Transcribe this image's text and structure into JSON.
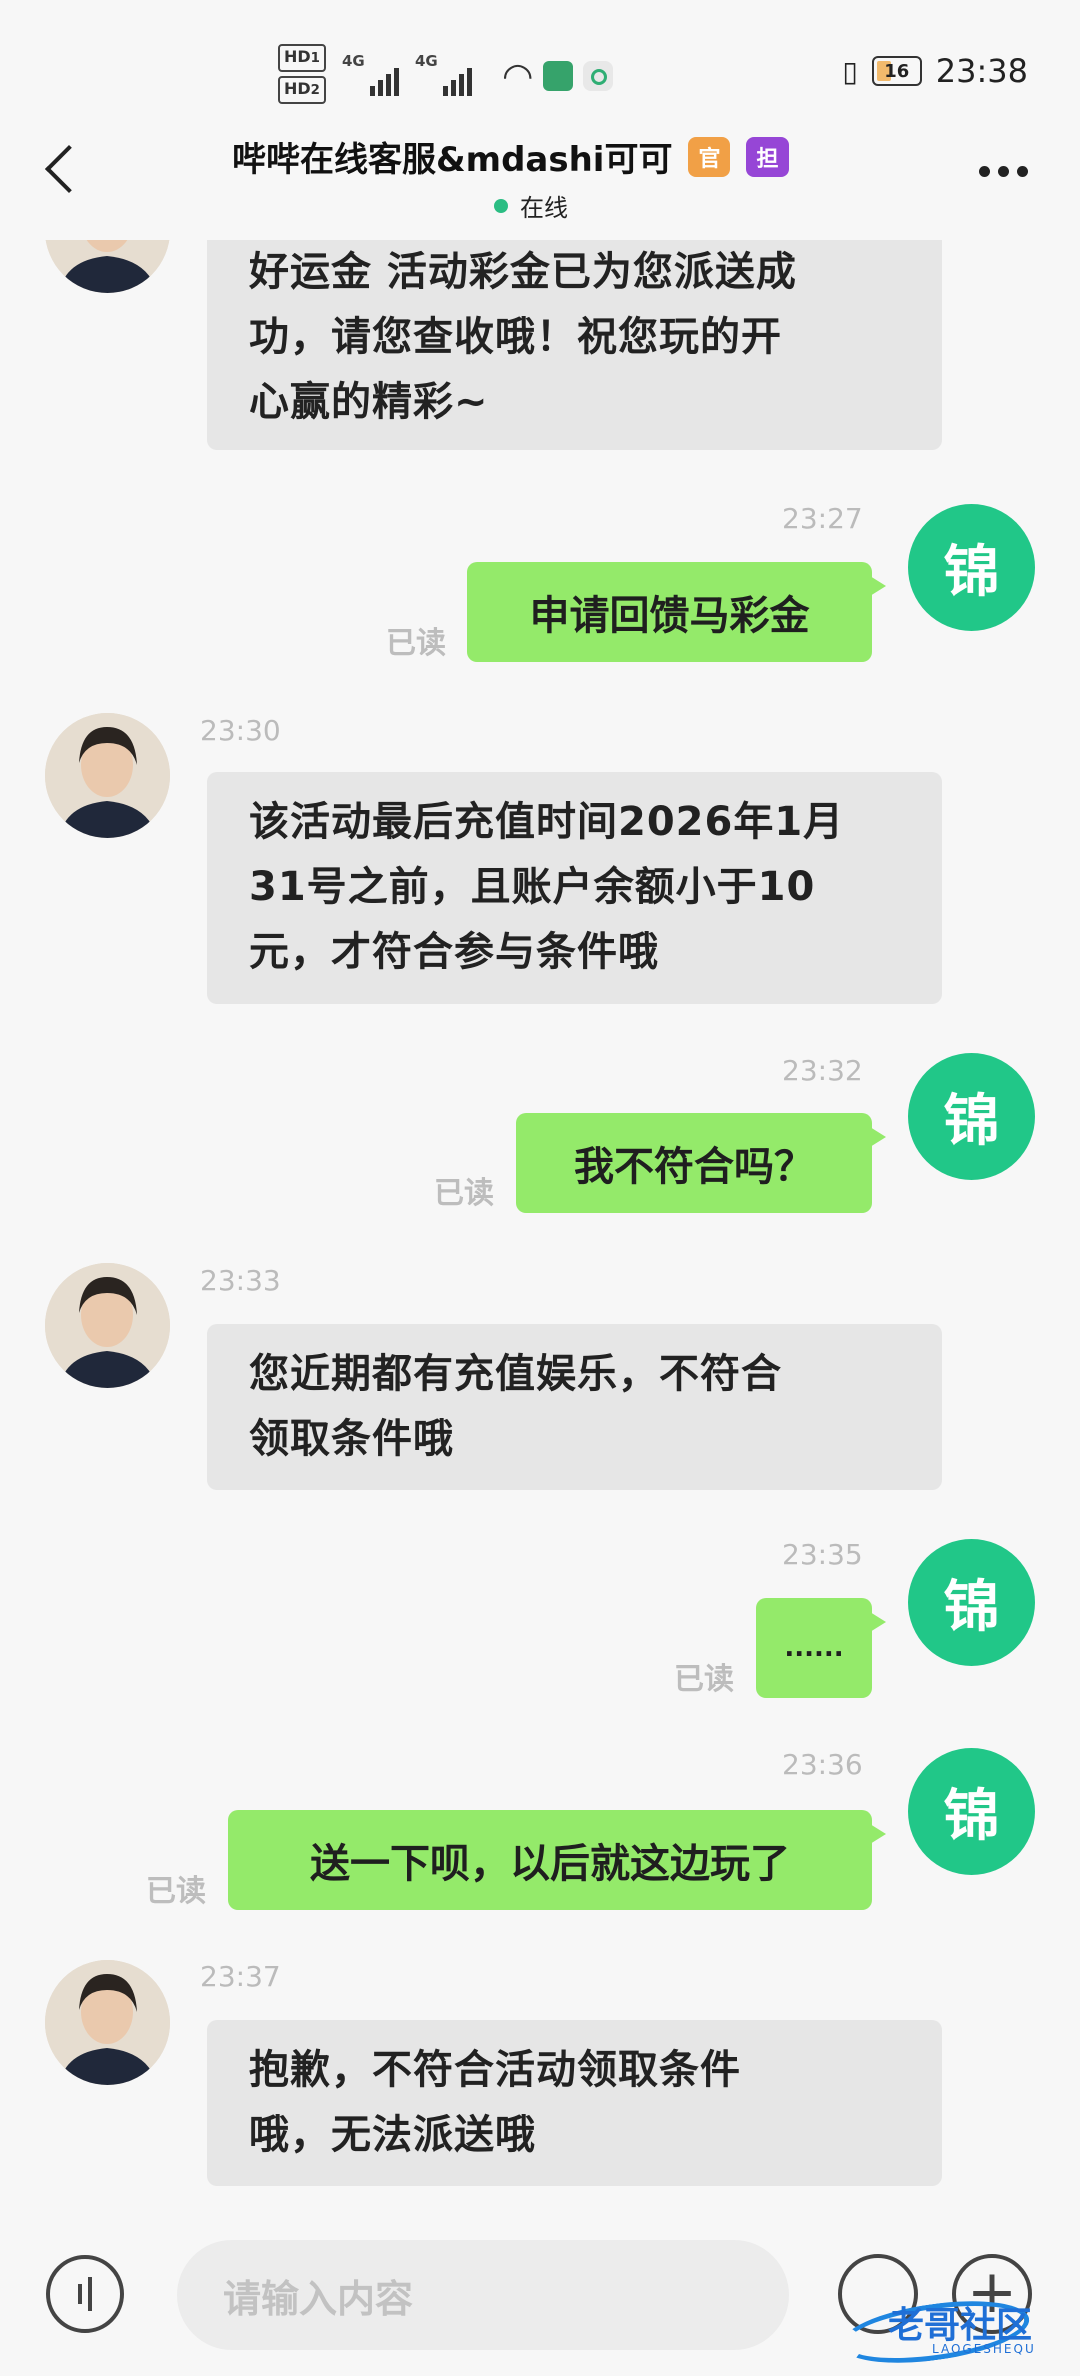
{
  "status_bar": {
    "hd1": "HD",
    "hd1_sub": "1",
    "hd2": "HD",
    "hd2_sub": "2",
    "net1": "4G",
    "net2": "4G",
    "battery": "16",
    "time": "23:38"
  },
  "header": {
    "title": "哔哔在线客服&mdashi可可",
    "tag_official": "官",
    "tag_guarantee": "担",
    "status": "在线"
  },
  "messages": [
    {
      "from": "cs",
      "text_lines": [
        "好运金 活动彩金已为您派送成",
        "功，请您查收哦！祝您玩的开",
        "心赢的精彩~"
      ]
    },
    {
      "from": "me",
      "time": "23:27",
      "text": "申请回馈马彩金",
      "read": "已读",
      "avatar": "锦"
    },
    {
      "from": "cs",
      "time": "23:30",
      "text_lines": [
        "该活动最后充值时间2026年1月",
        "31号之前，且账户余额小于10",
        "元，才符合参与条件哦"
      ]
    },
    {
      "from": "me",
      "time": "23:32",
      "text": "我不符合吗？",
      "read": "已读",
      "avatar": "锦"
    },
    {
      "from": "cs",
      "time": "23:33",
      "text_lines": [
        "您近期都有充值娱乐，不符合",
        "领取条件哦"
      ]
    },
    {
      "from": "me",
      "time": "23:35",
      "text": "......",
      "read": "已读",
      "avatar": "锦"
    },
    {
      "from": "me",
      "time": "23:36",
      "text": "送一下呗，以后就这边玩了",
      "read": "已读",
      "avatar": "锦"
    },
    {
      "from": "cs",
      "time": "23:37",
      "text_lines": [
        "抱歉，不符合活动领取条件",
        "哦，无法派送哦"
      ]
    }
  ],
  "input": {
    "placeholder": "请输入内容"
  },
  "watermark": {
    "text": "老哥社区",
    "sub": "LAOGESHEQU"
  },
  "colors": {
    "my_bubble": "#94ea6a",
    "my_avatar": "#21c788",
    "cs_bubble": "#e6e6e6",
    "online_dot": "#2bbd83"
  }
}
